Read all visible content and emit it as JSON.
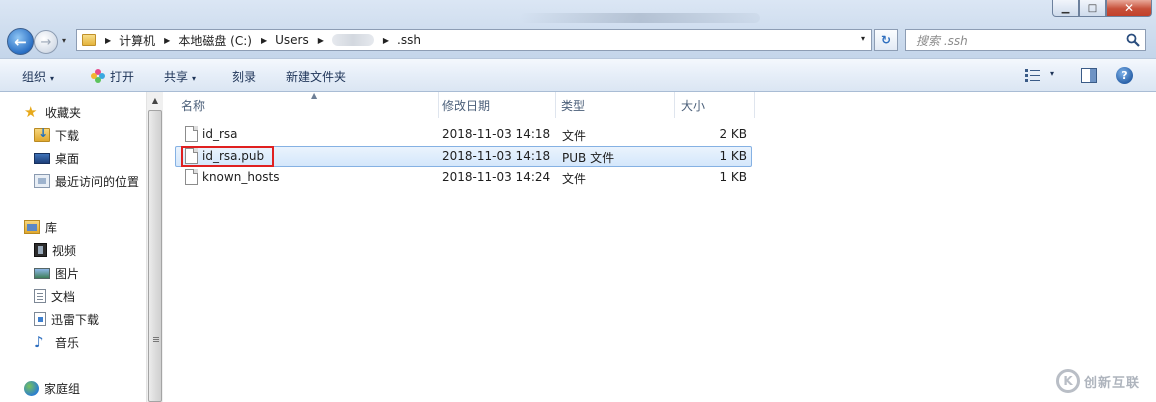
{
  "window": {
    "controls": {
      "minimize": "▁",
      "maximize": "□",
      "close": "✕"
    }
  },
  "navigation": {
    "back_glyph": "←",
    "forward_glyph": "→",
    "dropdown_glyph": "▾"
  },
  "address": {
    "crumbs": [
      "计算机",
      "本地磁盘 (C:)",
      "Users",
      "",
      ".ssh"
    ],
    "arrow_glyph": "▶",
    "dropdown_glyph": "▾",
    "refresh_glyph": "↻"
  },
  "search": {
    "placeholder": "搜索 .ssh"
  },
  "toolbar": {
    "organize": "组织",
    "open": "打开",
    "share": "共享",
    "burn": "刻录",
    "new_folder": "新建文件夹",
    "caret": "▾",
    "help": "?"
  },
  "sidebar": {
    "favorites": {
      "title": "收藏夹",
      "items": [
        "下载",
        "桌面",
        "最近访问的位置"
      ]
    },
    "libraries": {
      "title": "库",
      "items": [
        "视频",
        "图片",
        "文档",
        "迅雷下载",
        "音乐"
      ]
    },
    "homegroup": "家庭组"
  },
  "filelist": {
    "columns": [
      "名称",
      "修改日期",
      "类型",
      "大小"
    ],
    "sort_glyph": "▲",
    "rows": [
      {
        "name": "id_rsa",
        "date": "2018-11-03 14:18",
        "type": "文件",
        "size": "2 KB"
      },
      {
        "name": "id_rsa.pub",
        "date": "2018-11-03 14:18",
        "type": "PUB 文件",
        "size": "1 KB"
      },
      {
        "name": "known_hosts",
        "date": "2018-11-03 14:24",
        "type": "文件",
        "size": "1 KB"
      }
    ],
    "selected_row": 1
  },
  "watermark": {
    "logo": "K",
    "text": "创新互联"
  },
  "colors": {
    "accent": "#2f6fbf",
    "selection": "#d4e7fb",
    "highlight_box": "#e02020"
  }
}
